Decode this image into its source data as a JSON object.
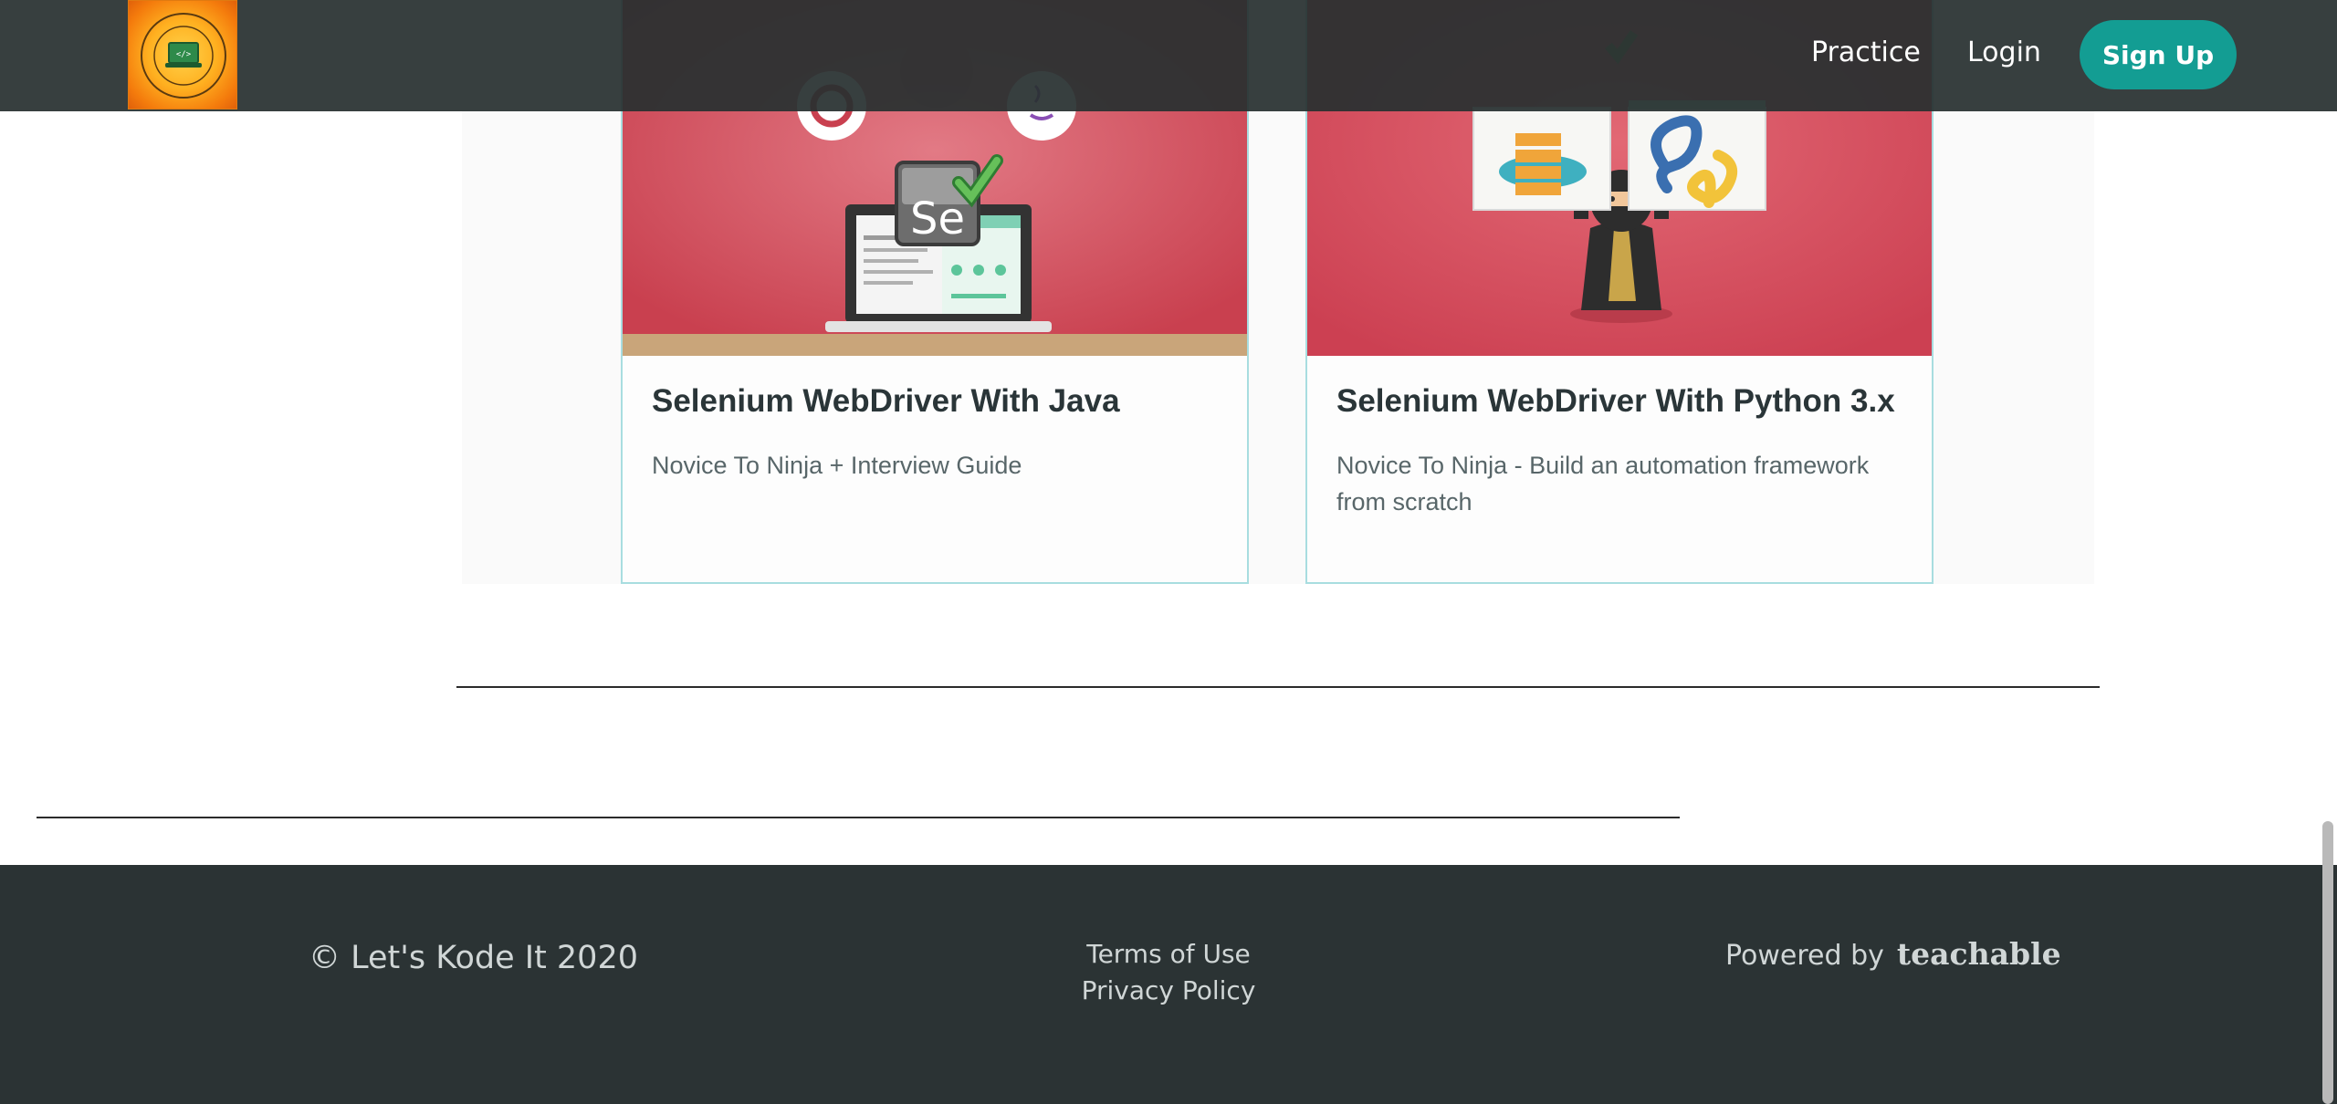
{
  "header": {
    "logo_alt": "Let's Kode It",
    "nav": {
      "practice": "Practice",
      "login": "Login",
      "signup": "Sign Up"
    }
  },
  "courses": [
    {
      "title": "Selenium WebDriver With Java",
      "subtitle": "Novice To Ninja + Interview Guide",
      "image_icon": "selenium-laptop-illustration"
    },
    {
      "title": "Selenium WebDriver With Python 3.x",
      "subtitle": "Novice To Ninja - Build an automation framework from scratch",
      "image_icon": "ninja-python-illustration"
    }
  ],
  "footer": {
    "copyright": "© Let's Kode It 2020",
    "links": [
      "Terms of Use",
      "Privacy Policy"
    ],
    "powered_by": "Powered by",
    "brand": "teachable"
  },
  "colors": {
    "header_bg": "#283030",
    "accent": "#139d93",
    "footer_bg": "#2b3334",
    "card_border": "#a8dde0",
    "card_image_bg": "#d9515f"
  }
}
